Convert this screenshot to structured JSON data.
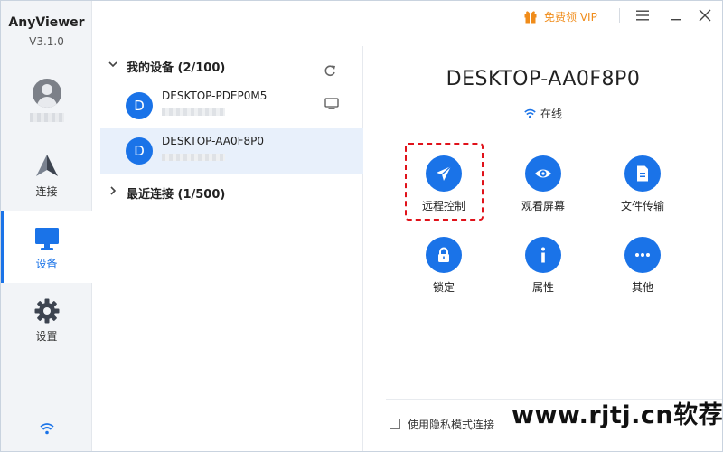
{
  "app": {
    "name": "AnyViewer",
    "version": "V3.1.0"
  },
  "topbar": {
    "vip_label": "免费领 VIP"
  },
  "nav": {
    "items": [
      {
        "label": "连接",
        "icon": "connect-icon",
        "active": false
      },
      {
        "label": "设备",
        "icon": "monitor-icon",
        "active": true
      },
      {
        "label": "设置",
        "icon": "gear-icon",
        "active": false
      }
    ]
  },
  "devices": {
    "my_devices": {
      "label": "我的设备 (2/100)"
    },
    "recent": {
      "label": "最近连接 (1/500)"
    },
    "list": [
      {
        "avatar": "D",
        "name": "DESKTOP-PDEP0M5"
      },
      {
        "avatar": "D",
        "name": "DESKTOP-AA0F8P0"
      }
    ]
  },
  "detail": {
    "title": "DESKTOP-AA0F8P0",
    "status": "在线",
    "actions": [
      {
        "label": "远程控制",
        "icon": "send-icon"
      },
      {
        "label": "观看屏幕",
        "icon": "eye-icon"
      },
      {
        "label": "文件传输",
        "icon": "file-icon"
      },
      {
        "label": "锁定",
        "icon": "lock-icon"
      },
      {
        "label": "属性",
        "icon": "info-icon"
      },
      {
        "label": "其他",
        "icon": "more-icon"
      }
    ],
    "privacy_label": "使用隐私模式连接"
  },
  "watermark": "www.rjtj.cn软荐网",
  "colors": {
    "accent": "#1a73e8",
    "vip": "#f08c1a",
    "highlight": "#e0121a"
  }
}
